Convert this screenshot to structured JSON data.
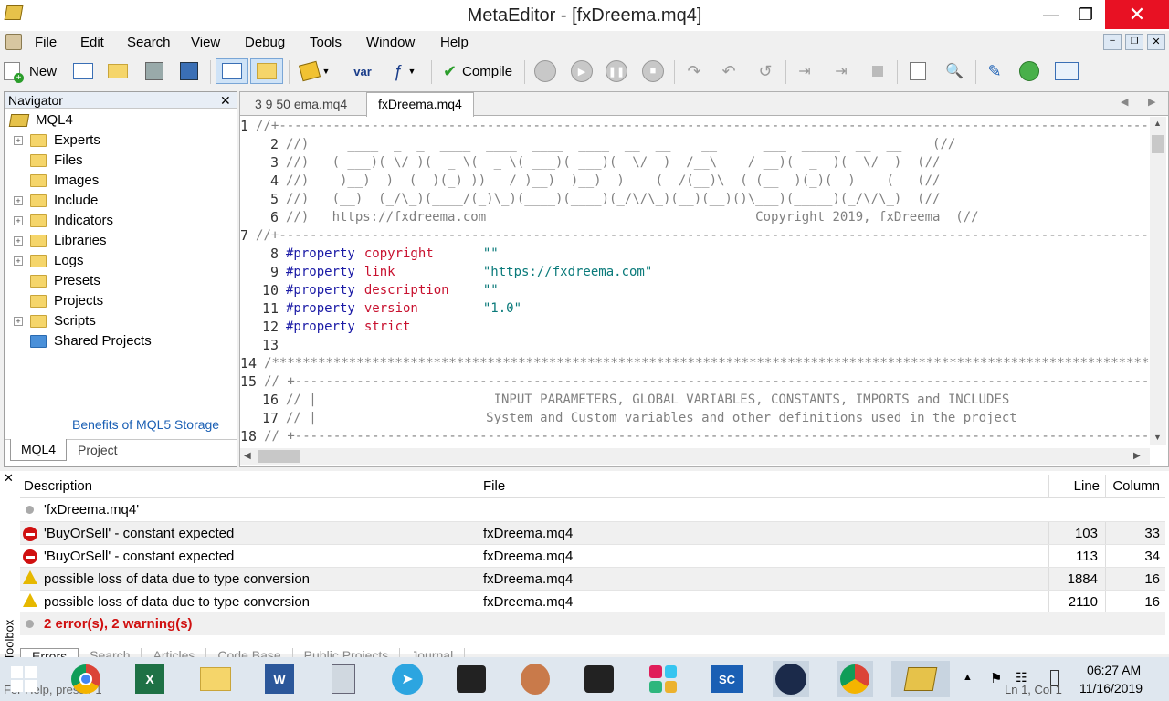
{
  "window": {
    "title": "MetaEditor - [fxDreema.mq4]"
  },
  "menu": [
    "File",
    "Edit",
    "Search",
    "View",
    "Debug",
    "Tools",
    "Window",
    "Help"
  ],
  "toolbar": {
    "new_label": "New",
    "compile_label": "Compile"
  },
  "navigator": {
    "title": "Navigator",
    "root": "MQL4",
    "items": [
      {
        "label": "Experts",
        "expandable": true
      },
      {
        "label": "Files",
        "expandable": false
      },
      {
        "label": "Images",
        "expandable": false
      },
      {
        "label": "Include",
        "expandable": true
      },
      {
        "label": "Indicators",
        "expandable": true
      },
      {
        "label": "Libraries",
        "expandable": true
      },
      {
        "label": "Logs",
        "expandable": true
      },
      {
        "label": "Presets",
        "expandable": false
      },
      {
        "label": "Projects",
        "expandable": false
      },
      {
        "label": "Scripts",
        "expandable": true
      },
      {
        "label": "Shared Projects",
        "expandable": false
      }
    ],
    "link": "Benefits of MQL5 Storage",
    "tabs": [
      "MQL4",
      "Project"
    ]
  },
  "editor": {
    "tabs": [
      "3 9 50 ema.mq4",
      "fxDreema.mq4"
    ],
    "active_tab": 1,
    "lines": [
      {
        "n": "1",
        "text": "//+------------------------------------------------------------------------------------------------------------------+//"
      },
      {
        "n": "2",
        "text": "//)     ____  _  _  ____  ____  ____  ____  __  __    __      ___  _____  __  __    (//"
      },
      {
        "n": "3",
        "text": "//)   ( ___)( \\/ )(  _ \\(  _ \\( ___)( ___)(  \\/  )  /__\\    / __)(  _  )(  \\/  )  (//"
      },
      {
        "n": "4",
        "text": "//)    )__)  )  (  )(_) ))   / )__)  )__)  )    (  /(__)\\  ( (__  )(_)(  )    (   (//"
      },
      {
        "n": "5",
        "text": "//)   (__)  (_/\\_)(____/(_)\\_)(____)(____)(_/\\/\\_)(__)(__)()\\___)(_____)(_/\\/\\_)  (//"
      },
      {
        "n": "6",
        "text": "//)   https://fxdreema.com                                   Copyright 2019, fxDreema  (//"
      },
      {
        "n": "7",
        "text": "//+------------------------------------------------------------------------------------------------------------------+//"
      },
      {
        "n": "8",
        "kw": "#property",
        "name": "copyright",
        "val": "\"\""
      },
      {
        "n": "9",
        "kw": "#property",
        "name": "link",
        "val": "\"https://fxdreema.com\""
      },
      {
        "n": "10",
        "kw": "#property",
        "name": "description",
        "val": "\"\""
      },
      {
        "n": "11",
        "kw": "#property",
        "name": "version",
        "val": "\"1.0\""
      },
      {
        "n": "12",
        "kw": "#property",
        "name": "strict",
        "val": ""
      },
      {
        "n": "13",
        "text": ""
      },
      {
        "n": "14",
        "text": "/****************************************************************************************************************************"
      },
      {
        "n": "15",
        "text": "// +---------------------------------------------------------------------------------------------------------------------"
      },
      {
        "n": "16",
        "text": "// |                       INPUT PARAMETERS, GLOBAL VARIABLES, CONSTANTS, IMPORTS and INCLUDES"
      },
      {
        "n": "17",
        "text": "// |                      System and Custom variables and other definitions used in the project"
      },
      {
        "n": "18",
        "text": "// +---------------------------------------------------------------------------------------------------------------------"
      }
    ]
  },
  "toolbox": {
    "side_label": "Toolbox",
    "columns": [
      "Description",
      "File",
      "Line",
      "Column"
    ],
    "file_row": "'fxDreema.mq4'",
    "rows": [
      {
        "type": "error",
        "desc": "'BuyOrSell' - constant expected",
        "file": "fxDreema.mq4",
        "line": "103",
        "col": "33"
      },
      {
        "type": "error",
        "desc": "'BuyOrSell' - constant expected",
        "file": "fxDreema.mq4",
        "line": "113",
        "col": "34"
      },
      {
        "type": "warning",
        "desc": "possible loss of data due to type conversion",
        "file": "fxDreema.mq4",
        "line": "1884",
        "col": "16"
      },
      {
        "type": "warning",
        "desc": "possible loss of data due to type conversion",
        "file": "fxDreema.mq4",
        "line": "2110",
        "col": "16"
      }
    ],
    "summary": "2 error(s), 2 warning(s)",
    "tabs": [
      "Errors",
      "Search",
      "Articles",
      "Code Base",
      "Public Projects",
      "Journal"
    ]
  },
  "status": {
    "help": "For Help, press F1",
    "position": "Ln 1, Col 1"
  },
  "taskbar": {
    "time": "06:27 AM",
    "date": "11/16/2019"
  },
  "colors": {
    "keyword": "#1a1aa6",
    "name": "#c8102e",
    "string": "#0a7a7a",
    "comment": "#808080",
    "error": "#d01010"
  }
}
